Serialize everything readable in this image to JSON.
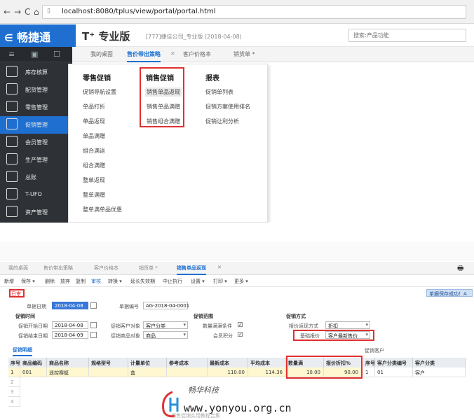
{
  "browser": {
    "url": "localhost:8080/tplus/view/portal/portal.html"
  },
  "app": {
    "logo": "畅捷通",
    "product": "T⁺ 专业版",
    "company": "[777]捷佳公司_专业版  (2018-04-08)",
    "search_placeholder": "搜索:产品功能"
  },
  "tabs": [
    "我的桌面",
    "售价带出策略",
    "客户价格本",
    "销货单 *"
  ],
  "sidebar": [
    {
      "label": "库存核算",
      "icon": "inventory-icon"
    },
    {
      "label": "配货管理",
      "icon": "distribution-icon"
    },
    {
      "label": "零售管理",
      "icon": "retail-icon"
    },
    {
      "label": "促销管理",
      "icon": "promotion-icon"
    },
    {
      "label": "会员管理",
      "icon": "member-icon"
    },
    {
      "label": "生产管理",
      "icon": "production-icon"
    },
    {
      "label": "总账",
      "icon": "ledger-icon"
    },
    {
      "label": "T-UFO",
      "icon": "ufo-icon"
    },
    {
      "label": "资产管理",
      "icon": "asset-icon"
    }
  ],
  "flyout": {
    "col1_title": "零售促销",
    "col1_items": [
      "促销导航设置",
      "单品打折",
      "单品返现",
      "单品满赠",
      "组合满返",
      "组合满赠",
      "整单返现",
      "整单满赠",
      "整单满单品优惠"
    ],
    "col2_title": "销售促销",
    "col2_items": [
      "销售单品返现",
      "销售单品满赠",
      "销售组合满赠"
    ],
    "col3_title": "报表",
    "col3_items": [
      "促销单列表",
      "促销方案使用排名",
      "促销让利分析"
    ]
  },
  "bottom": {
    "tabs": [
      "我的桌面",
      "售价带出策略",
      "客户价格本",
      "销货单 *",
      "销售单品返现"
    ],
    "toolbar": [
      "新增",
      "保存 ▾",
      "删除",
      "放弃",
      "复制",
      "审核",
      "转换 ▾",
      "延长失效期",
      "中止执行",
      "设置 ▾",
      "打印 ▾",
      "更多 ▾"
    ],
    "notice": "单据保存成功！A",
    "status": "已审",
    "labels": {
      "doc_date": "单据日期",
      "doc_no": "单据编号",
      "promo_time": "促销时间",
      "start_date": "促销开始日期",
      "end_date": "促销结束日期",
      "promo_range": "促销范围",
      "promo_customer": "促销客户对象",
      "promo_goods": "促销商品对象",
      "data_cond": "数量满满条件",
      "member_points": "会员积分",
      "promo_method": "促销方式",
      "rebate_mode": "报价返现方式",
      "base_price": "基础报价"
    },
    "values": {
      "doc_date": "2018-04-08",
      "doc_no": "AG-2018-04-0001",
      "start_date": "2018-04-08",
      "end_date": "2018-04-09",
      "promo_customer": "客户分类",
      "promo_goods": "商品",
      "rebate_mode": "折扣",
      "base_price": "客户最新售价"
    },
    "section_tab": "促销明细",
    "right_section": "促销客户",
    "grid_headers": [
      "序号",
      "商品编码",
      "商品名称",
      "规格型号",
      "计量单位",
      "参考成本",
      "最新成本",
      "平均成本",
      "数量满",
      "报价折扣%"
    ],
    "grid_row": [
      "1",
      "001",
      "遥控赛艇",
      "",
      "盒",
      "",
      "110.00",
      "114.36",
      "10.00",
      "90.00"
    ],
    "row_numbers": [
      "2",
      "3",
      "4"
    ],
    "right_headers": [
      "序号",
      "客户分类编号",
      "客户分类"
    ],
    "right_row": [
      "1",
      "01",
      "客户"
    ],
    "footer_text": "销售促销实用教程合集"
  },
  "watermark": {
    "cn": "畅华科技",
    "url": "www.yonyou.org.cn"
  },
  "colors": {
    "brand_blue": "#1e6fd0",
    "sidebar_dark": "#2e3237",
    "highlight_red": "#e03030",
    "row_yellow": "#fff7cf"
  }
}
